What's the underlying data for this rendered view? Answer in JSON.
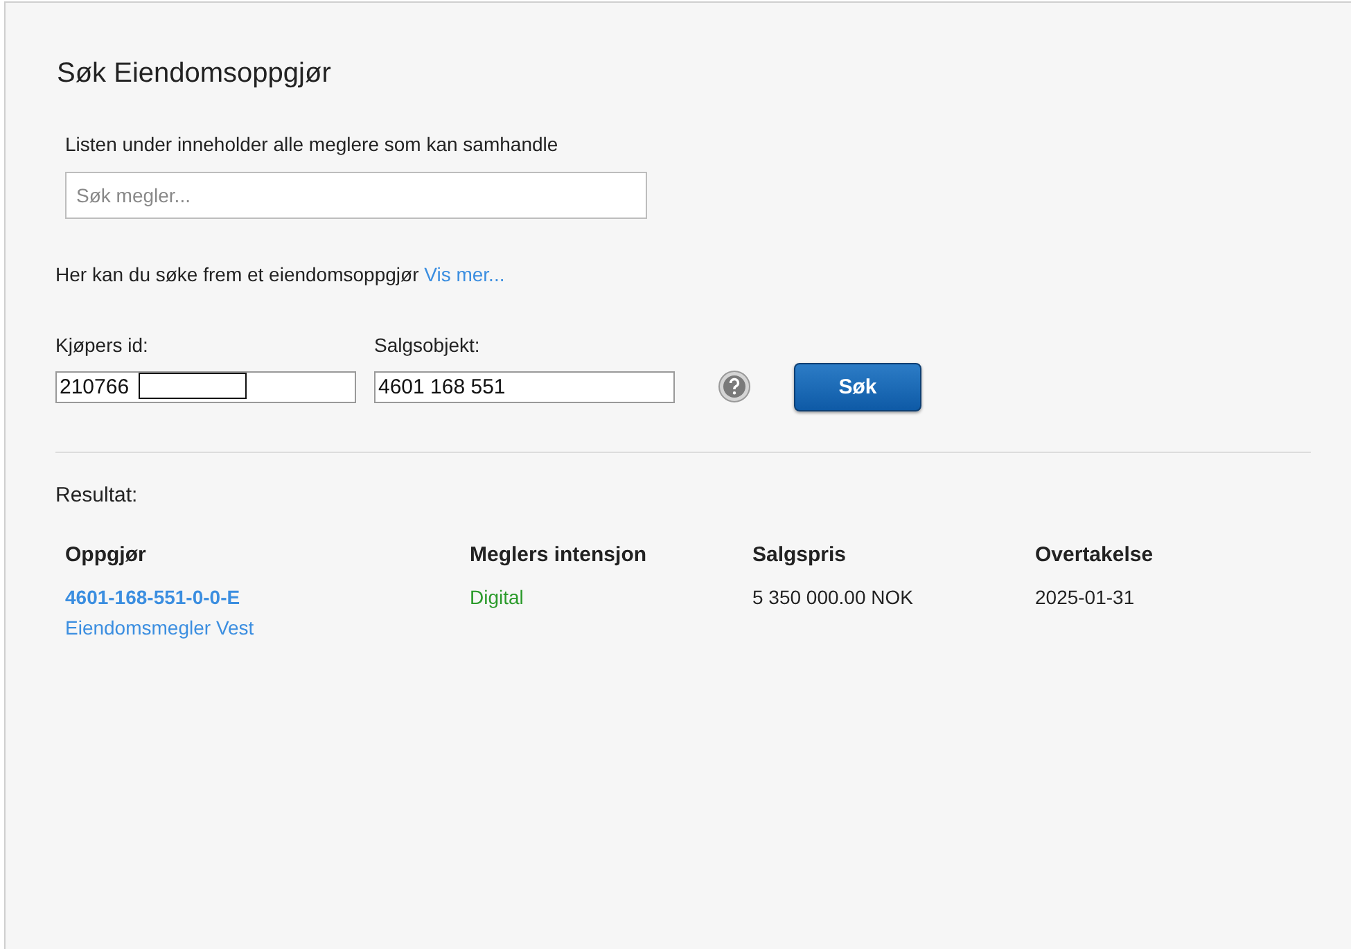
{
  "title": "Søk Eiendomsoppgjør",
  "broker_search": {
    "label": "Listen under inneholder alle meglere som kan samhandle",
    "placeholder": "Søk megler..."
  },
  "intro": {
    "text": "Her kan du søke frem et eiendomsoppgjør",
    "link": "Vis mer..."
  },
  "fields": [
    {
      "label": "Kjøpers id:",
      "value": "210766",
      "redacted": true
    },
    {
      "label": "Salgsobjekt:",
      "value": "4601 168 551",
      "redacted": false
    }
  ],
  "search_button": "Søk",
  "result_label": "Resultat:",
  "table": {
    "columns": [
      "Oppgjør",
      "Meglers intensjon",
      "Salgspris",
      "Overtakelse"
    ],
    "rows": [
      {
        "settlement": "4601-168-551-0-0-E",
        "broker": "Eiendomsmegler Vest",
        "intention": "Digital",
        "price": "5 350 000.00 NOK",
        "takeover": "2025-01-31"
      }
    ]
  }
}
